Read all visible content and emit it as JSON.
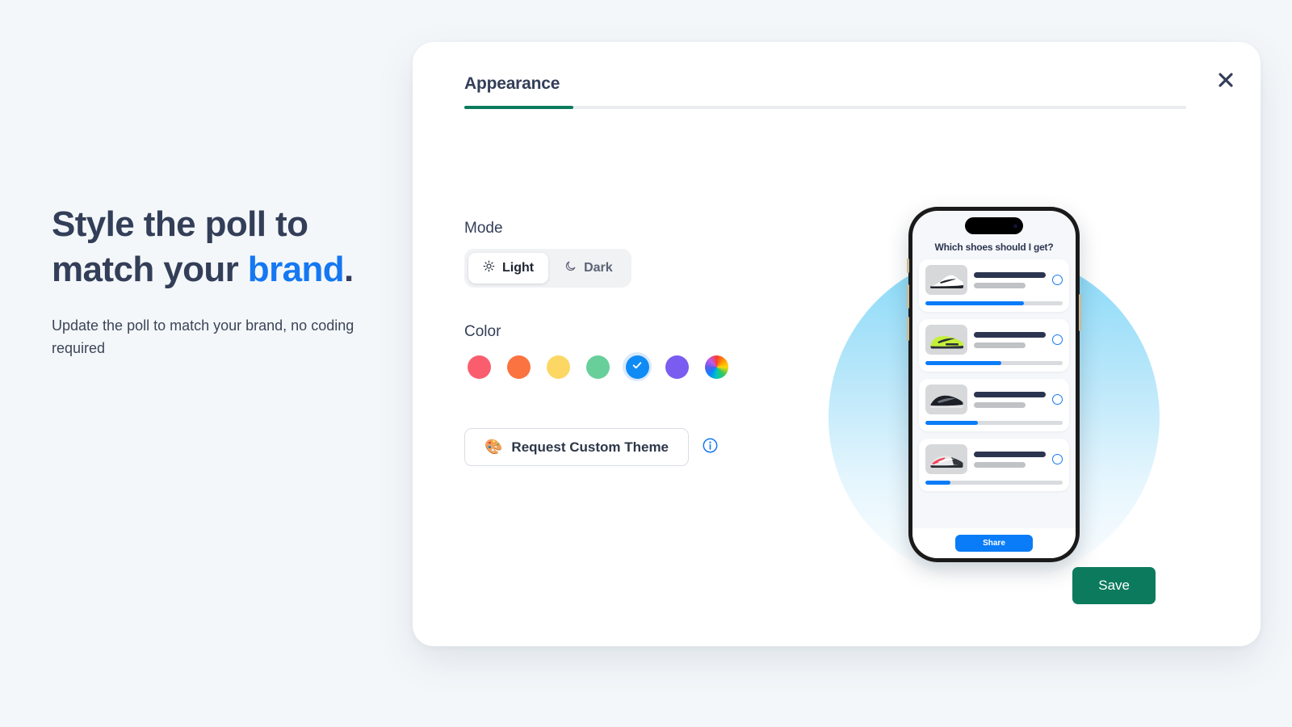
{
  "hero": {
    "title_line1": "Style the poll to",
    "title_line2_pre": "match your ",
    "title_accent": "brand",
    "title_period": ".",
    "subtitle": "Update the poll to match your brand, no coding required",
    "accent_color": "#1578f2"
  },
  "modal": {
    "close_icon": "close-icon",
    "tabs": [
      {
        "label": "Appearance",
        "active": true
      }
    ],
    "mode": {
      "label": "Mode",
      "options": [
        {
          "label": "Light",
          "icon": "sun-icon",
          "selected": true
        },
        {
          "label": "Dark",
          "icon": "moon-icon",
          "selected": false
        }
      ]
    },
    "color": {
      "label": "Color",
      "swatches": [
        {
          "name": "red",
          "hex": "#fa5e6e",
          "selected": false
        },
        {
          "name": "orange",
          "hex": "#fb7340",
          "selected": false
        },
        {
          "name": "yellow",
          "hex": "#fcd764",
          "selected": false
        },
        {
          "name": "green",
          "hex": "#68cf9b",
          "selected": false
        },
        {
          "name": "blue",
          "hex": "#0f8bf5",
          "selected": true
        },
        {
          "name": "purple",
          "hex": "#7a5cf0",
          "selected": false
        },
        {
          "name": "rainbow",
          "hex": "rainbow",
          "selected": false
        }
      ]
    },
    "theme": {
      "button_emoji": "🎨",
      "button_label": "Request Custom Theme",
      "info_icon": "info-icon"
    },
    "save_label": "Save"
  },
  "preview": {
    "poll_title": "Which shoes should I get?",
    "share_label": "Share",
    "options": [
      {
        "shoe": "white-black-sneaker",
        "percent": 72
      },
      {
        "shoe": "volt-green-sneaker",
        "percent": 55
      },
      {
        "shoe": "black-sneaker",
        "percent": 38
      },
      {
        "shoe": "red-gray-sneaker",
        "percent": 18
      }
    ]
  }
}
